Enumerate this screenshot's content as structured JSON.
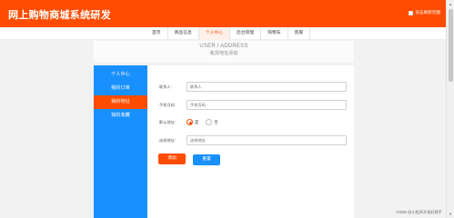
{
  "header": {
    "site_title": "网上购物商城系统研发",
    "right_label": "双击刷新页面"
  },
  "nav": {
    "items": [
      "首页",
      "商品信息",
      "个人中心",
      "后台管理",
      "购物车",
      "客服"
    ],
    "active_index": 2
  },
  "section": {
    "title_en": "USER / ADDRESS",
    "title_cn": "收货地址添加"
  },
  "sidebar": {
    "items": [
      "个人中心",
      "我的订单",
      "我的地址",
      "我的收藏"
    ],
    "active_index": 2
  },
  "form": {
    "contact_label": "联系人:",
    "contact_placeholder": "联系人",
    "phone_label": "手机号码:",
    "phone_placeholder": "手机号码",
    "default_label": "默认地址:",
    "option_yes": "是",
    "option_no": "否",
    "default_selected": "是",
    "address_label": "选择地址:",
    "address_placeholder": "选择地址"
  },
  "buttons": {
    "add": "添加",
    "reset": "重置"
  },
  "watermark": "CSDN @小程序开发好帮手",
  "colors": {
    "brand_orange": "#ff4c00",
    "sidebar_blue": "#1890ff",
    "reset_blue": "#1890ff"
  }
}
